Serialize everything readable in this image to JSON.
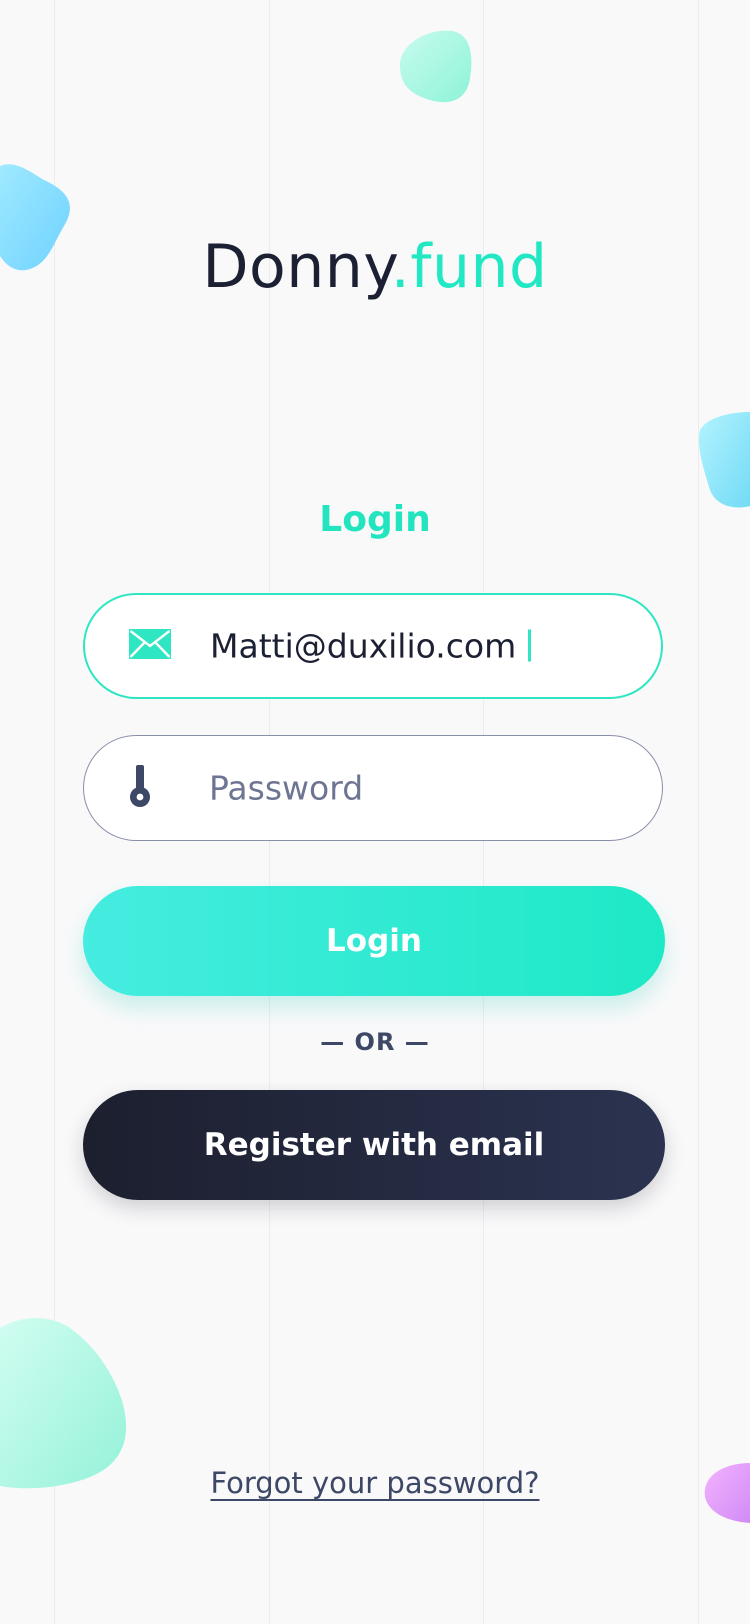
{
  "logo": {
    "brand": "Donny",
    "tld": ".fund"
  },
  "heading": "Login",
  "email_field": {
    "value": "Matti@duxilio.com",
    "icon": "mail-icon"
  },
  "password_field": {
    "placeholder": "Password",
    "icon": "key-icon"
  },
  "login_button": {
    "label": "Login"
  },
  "separator": {
    "label": "— OR —"
  },
  "register_button": {
    "label": "Register with email"
  },
  "forgot_link": {
    "label": "Forgot your password?"
  },
  "colors": {
    "accent": "#22e5c0",
    "dark": "#1c2033",
    "background": "#f9f9fa",
    "muted_text": "#6e7592"
  }
}
